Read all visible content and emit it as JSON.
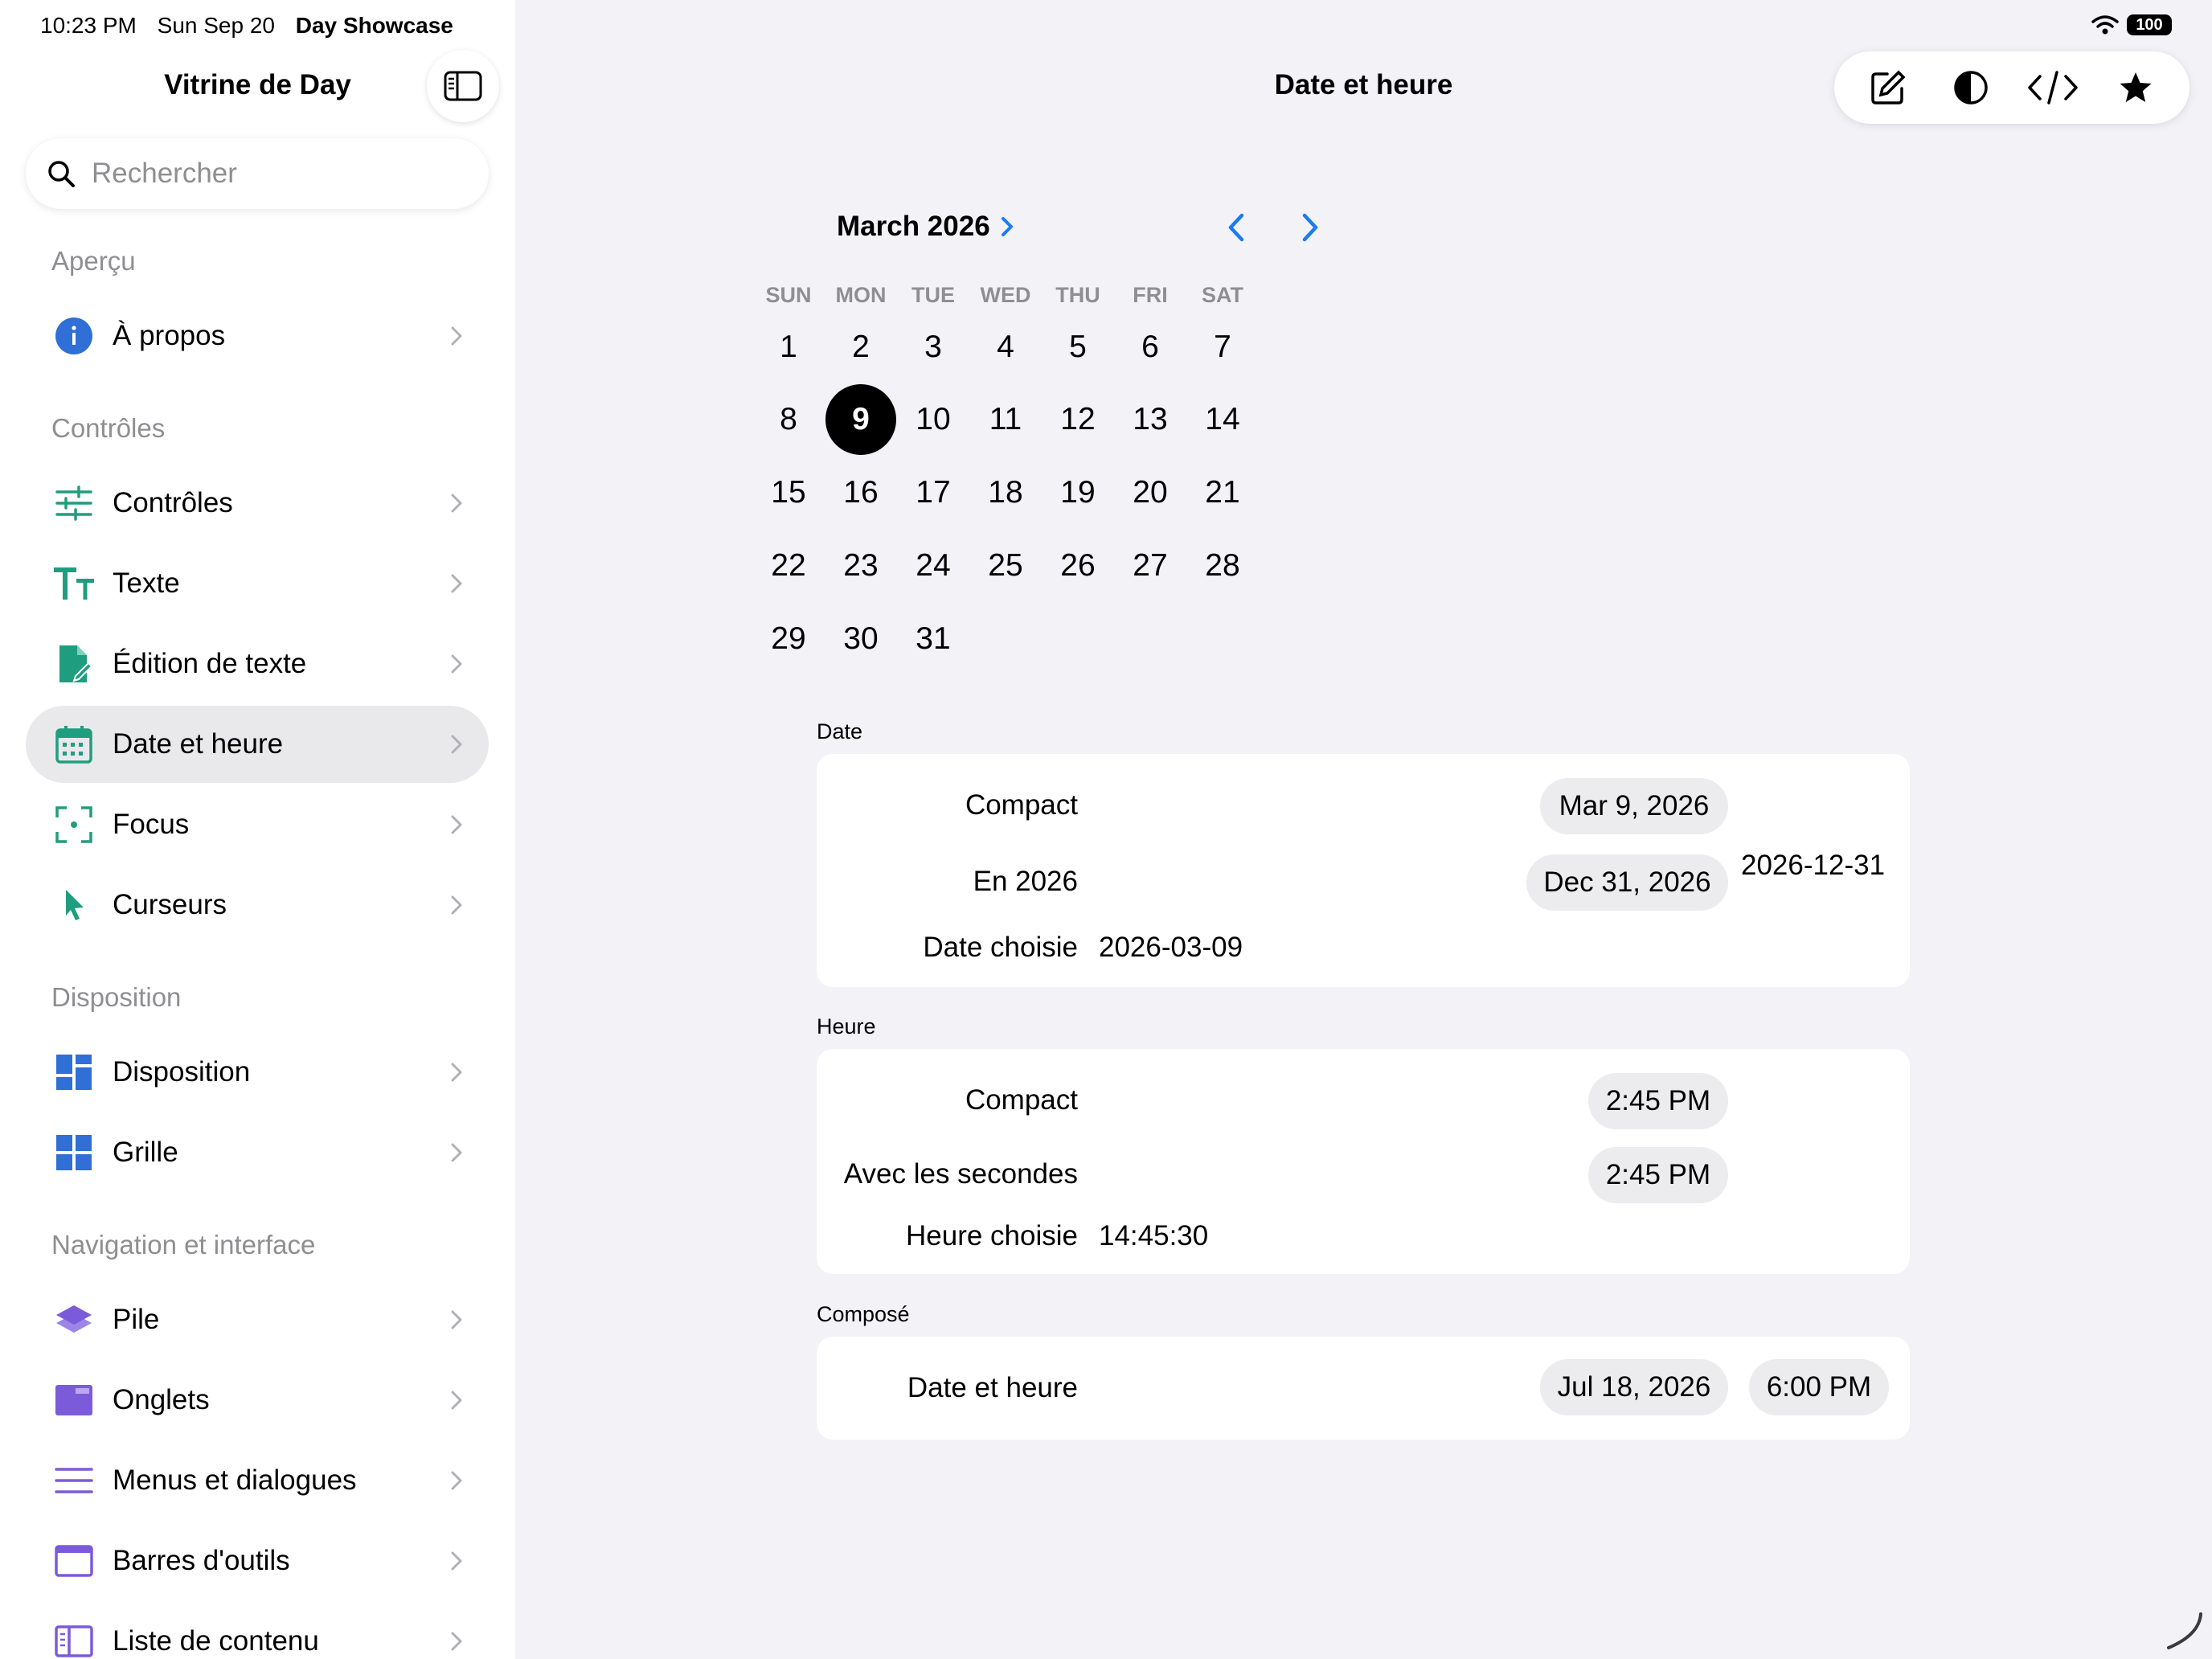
{
  "status": {
    "time": "10:23 PM",
    "date": "Sun Sep 20",
    "app": "Day Showcase",
    "battery": "100"
  },
  "sidebar": {
    "title": "Vitrine de Day",
    "search_placeholder": "Rechercher",
    "sections": {
      "apercu": "Aperçu",
      "controles": "Contrôles",
      "disposition": "Disposition",
      "navigation": "Navigation et interface"
    },
    "items": [
      {
        "label": "À propos",
        "icon": "info-icon"
      },
      {
        "label": "Contrôles",
        "icon": "sliders-icon"
      },
      {
        "label": "Texte",
        "icon": "text-size-icon"
      },
      {
        "label": "Édition de texte",
        "icon": "document-edit-icon"
      },
      {
        "label": "Date et heure",
        "icon": "calendar-icon"
      },
      {
        "label": "Focus",
        "icon": "focus-icon"
      },
      {
        "label": "Curseurs",
        "icon": "pointer-icon"
      },
      {
        "label": "Disposition",
        "icon": "layout-icon"
      },
      {
        "label": "Grille",
        "icon": "grid-icon"
      },
      {
        "label": "Pile",
        "icon": "stack-icon"
      },
      {
        "label": "Onglets",
        "icon": "tabs-icon"
      },
      {
        "label": "Menus et dialogues",
        "icon": "menu-lines-icon"
      },
      {
        "label": "Barres d'outils",
        "icon": "toolbar-icon"
      },
      {
        "label": "Liste de contenu",
        "icon": "sidebar-list-icon"
      }
    ],
    "selected": "Date et heure"
  },
  "main": {
    "title": "Date et heure",
    "toolbar": [
      "compose-icon",
      "contrast-icon",
      "code-icon",
      "star-icon"
    ],
    "calendar": {
      "month_label": "March 2026",
      "weekdays": [
        "SUN",
        "MON",
        "TUE",
        "WED",
        "THU",
        "FRI",
        "SAT"
      ],
      "days": [
        "1",
        "2",
        "3",
        "4",
        "5",
        "6",
        "7",
        "8",
        "9",
        "10",
        "11",
        "12",
        "13",
        "14",
        "15",
        "16",
        "17",
        "18",
        "19",
        "20",
        "21",
        "22",
        "23",
        "24",
        "25",
        "26",
        "27",
        "28",
        "29",
        "30",
        "31"
      ],
      "first_weekday_index": 0,
      "selected_day": "9"
    },
    "groups": {
      "date": {
        "label": "Date",
        "compact_label": "Compact",
        "compact_value": "Mar 9, 2026",
        "in2026_label": "En 2026",
        "in2026_value": "Dec 31, 2026",
        "in2026_text": "2026-12-31",
        "chosen_label": "Date choisie",
        "chosen_value": "2026-03-09"
      },
      "time": {
        "label": "Heure",
        "compact_label": "Compact",
        "compact_value": "2:45 PM",
        "seconds_label": "Avec les secondes",
        "seconds_value": "2:45 PM",
        "chosen_label": "Heure choisie",
        "chosen_value": "14:45:30"
      },
      "composed": {
        "label": "Composé",
        "datetime_label": "Date et heure",
        "date_value": "Jul 18, 2026",
        "time_value": "6:00 PM"
      }
    },
    "colors": {
      "accent_blue": "#1a7cf0",
      "teal": "#1f9e7f",
      "layout_blue": "#2f6fd6",
      "purple": "#7b5bd9"
    }
  }
}
